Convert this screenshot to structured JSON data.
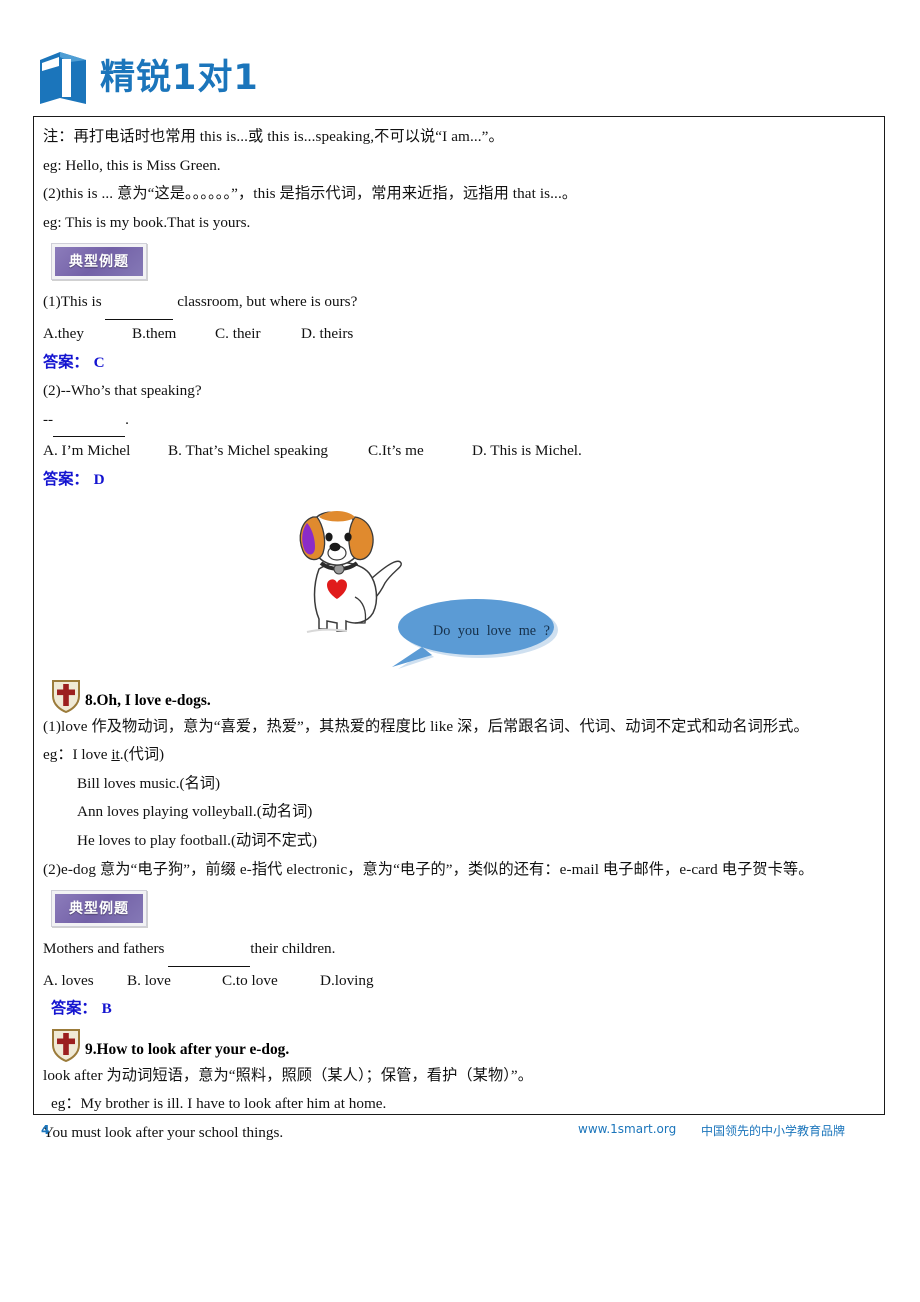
{
  "header": {
    "logo_icon": "open-book-one-logo-icon",
    "brand": "精锐1对1",
    "brand_color": "#1b75bb"
  },
  "document": {
    "blocks": [
      {
        "type": "text",
        "id": "note_line",
        "text": "注：再打电话时也常用 this is...或 this is...speaking,不可以说“I am...”。"
      },
      {
        "type": "text",
        "id": "eg_hello",
        "text": "eg: Hello, this is Miss Green."
      },
      {
        "type": "text",
        "id": "this_is_meaning",
        "text": "(2)this is ...  意为“这是。。。。。。”，this 是指示代词，常用来近指，远指用 that is...。"
      },
      {
        "type": "text",
        "id": "eg_my_book",
        "text": "eg:    This is my book.That is yours."
      }
    ],
    "example_badge_1": "典型例题",
    "question_1": {
      "stem_before": "(1)This is ",
      "stem_blank": "________",
      "stem_after": " classroom, but where is ours?",
      "options": [
        {
          "label": "A.they"
        },
        {
          "label": "B.them"
        },
        {
          "label": "C. their"
        },
        {
          "label": "D. theirs"
        }
      ],
      "answer_label": "答案：",
      "answer_value": "C"
    },
    "question_2": {
      "stem": "(2)--Who’s that speaking?",
      "dash_line_prefix": "--",
      "dash_line_blank": "________",
      "dash_line_suffix": ".",
      "options": [
        {
          "label": "A. I’m Michel"
        },
        {
          "label": "B. That’s Michel speaking"
        },
        {
          "label": "C.It’s me"
        },
        {
          "label": "D. This is Michel."
        }
      ],
      "answer_label": "答案：",
      "answer_value": "D"
    },
    "illustration": {
      "dog_icon": "cartoon-beagle-dog-icon",
      "heart_icon": "red-heart-icon",
      "bubble_icon": "speech-bubble-icon",
      "bubble_text": "Do  you  love me ?",
      "bubble_color": "#5b9bd5",
      "dog_ear_color": "#e08a2e",
      "heart_color": "#e01b1b"
    },
    "section_8": {
      "shield_icon": "shield-cross-icon",
      "title": "8.Oh, I love e-dogs.",
      "para_1": "(1)love  作及物动词，意为“喜爱，热爱”，其热爱的程度比 like 深，后常跟名词、代词、动词不定式和动名词形式。",
      "examples": [
        {
          "prefix": "eg：I love ",
          "underlined": "it",
          "suffix": ".(代词)"
        },
        {
          "prefix": "",
          "underlined": "",
          "suffix": "Bill loves music.(名词)"
        },
        {
          "prefix": "",
          "underlined": "",
          "suffix": "Ann loves playing volleyball.(动名词)"
        },
        {
          "prefix": "",
          "underlined": "",
          "suffix": "He loves to play football.(动词不定式)"
        }
      ],
      "para_2": "(2)e-dog 意为“电子狗”，前缀 e-指代 electronic，意为“电子的”，类似的还有：e-mail 电子邮件，e-card 电子贺卡等。",
      "example_badge": "典型例题",
      "question": {
        "stem_before": "Mothers and fathers ",
        "stem_blank": "__________",
        "stem_after": "their children.",
        "options": [
          {
            "label": "A. loves"
          },
          {
            "label": "B. love"
          },
          {
            "label": "C.to love"
          },
          {
            "label": "D.loving"
          }
        ],
        "answer_label": "答案：",
        "answer_value": "B"
      }
    },
    "section_9": {
      "shield_icon": "shield-cross-icon",
      "title": "9.How to look after your e-dog.",
      "para_1": "look after  为动词短语，意为“照料，照顾（某人）；保管，看护（某物）”。",
      "example_1": "eg：My brother is ill. I have to look after him at home.",
      "example_2": "You must look after your school things."
    }
  },
  "footer": {
    "page_number": "4",
    "url": "www.1smart.org",
    "slogan": "中国领先的中小学教育品牌"
  }
}
